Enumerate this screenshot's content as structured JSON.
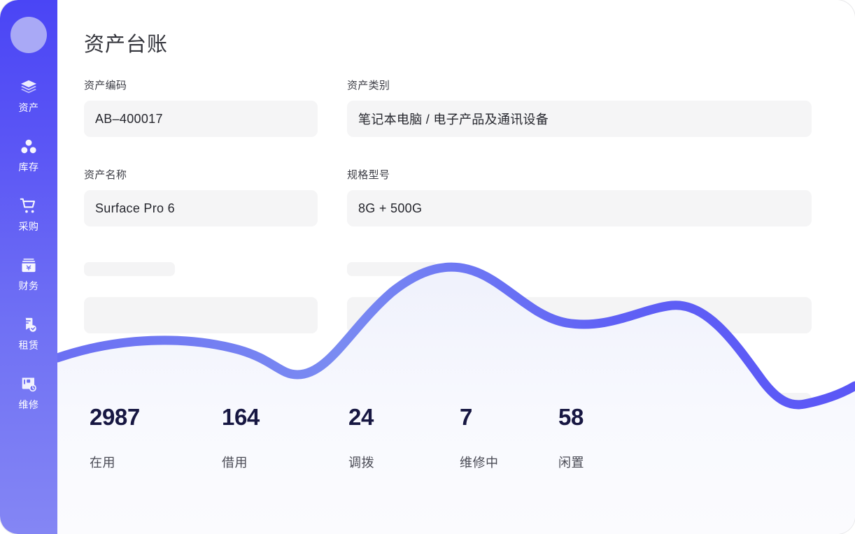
{
  "sidebar": {
    "avatar_name": "user-avatar",
    "gradient_from": "#4A45F5",
    "gradient_to": "#8486F4",
    "items": [
      {
        "label": "资产",
        "icon": "layers-icon"
      },
      {
        "label": "库存",
        "icon": "inventory-icon"
      },
      {
        "label": "采购",
        "icon": "cart-icon"
      },
      {
        "label": "财务",
        "icon": "finance-icon"
      },
      {
        "label": "租赁",
        "icon": "lease-icon"
      },
      {
        "label": "维修",
        "icon": "repair-icon"
      }
    ]
  },
  "page": {
    "title": "资产台账"
  },
  "form": {
    "fields": [
      {
        "label": "资产编码",
        "value": "AB–400017"
      },
      {
        "label": "资产类别",
        "value": "笔记本电脑 / 电子产品及通讯设备"
      },
      {
        "label": "资产名称",
        "value": "Surface Pro 6"
      },
      {
        "label": "规格型号",
        "value": "8G + 500G"
      }
    ]
  },
  "stats": [
    {
      "value": "2987",
      "label": "在用"
    },
    {
      "value": "164",
      "label": "借用"
    },
    {
      "value": "24",
      "label": "调拨"
    },
    {
      "value": "7",
      "label": "维修中"
    },
    {
      "value": "58",
      "label": "闲置"
    }
  ],
  "decoration": {
    "wave_stroke_from": "#7A8BF2",
    "wave_stroke_to": "#5B57F6",
    "wave_fill": "#F6F7FD"
  }
}
